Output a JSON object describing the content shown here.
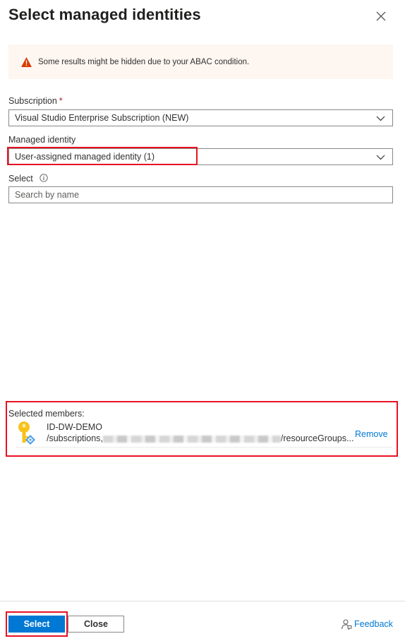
{
  "panel": {
    "title": "Select managed identities",
    "close_icon": "close-icon"
  },
  "banner": {
    "icon": "warning-icon",
    "text": "Some results might be hidden due to your ABAC condition."
  },
  "subscription": {
    "label": "Subscription",
    "required_marker": "*",
    "value": "Visual Studio Enterprise Subscription (NEW)"
  },
  "managed_identity": {
    "label": "Managed identity",
    "value": "User-assigned managed identity (1)"
  },
  "select_field": {
    "label": "Select",
    "placeholder": "Search by name"
  },
  "selected_members": {
    "label": "Selected members:",
    "items": [
      {
        "name": "ID-DW-DEMO",
        "path_prefix": "/subscriptions,",
        "path_suffix": "/resourceGroups...",
        "remove_label": "Remove"
      }
    ]
  },
  "footer": {
    "select_label": "Select",
    "close_label": "Close",
    "feedback_label": "Feedback"
  },
  "colors": {
    "accent": "#0078d4",
    "highlight_border": "#e81123",
    "warning": "#d83b01",
    "banner_bg": "#fdf6f1"
  }
}
